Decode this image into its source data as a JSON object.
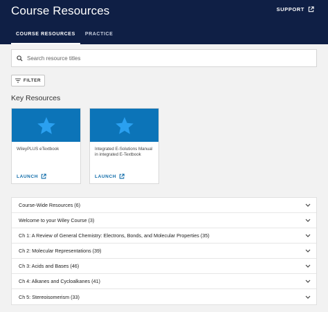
{
  "header": {
    "title": "Course Resources",
    "support_label": "SUPPORT",
    "tabs": [
      {
        "label": "COURSE RESOURCES",
        "active": true
      },
      {
        "label": "PRACTICE",
        "active": false
      }
    ],
    "bg_color": "#0f1f45"
  },
  "search": {
    "placeholder": "Search resource titles",
    "value": ""
  },
  "filter": {
    "label": "FILTER"
  },
  "key_resources": {
    "heading": "Key Resources",
    "cards": [
      {
        "title": "WileyPLUS eTextbook",
        "launch_label": "LAUNCH",
        "icon": "star-icon"
      },
      {
        "title": "Integrated E-Solutions Manual in integrated E-Textbook",
        "launch_label": "LAUNCH",
        "icon": "star-icon"
      }
    ],
    "banner_color": "#0c74b8",
    "star_color": "#2aa0f0"
  },
  "accordion": [
    "Course-Wide Resources (6)",
    "Welcome to your Wiley Course (3)",
    "Ch 1: A Review of General Chemistry: Electrons, Bonds, and Molecular Properties (35)",
    "Ch 2: Molecular Representations (39)",
    "Ch 3: Acids and Bases (46)",
    "Ch 4: Alkanes and Cycloalkanes (41)",
    "Ch 5: Stereoisomerism (33)"
  ]
}
